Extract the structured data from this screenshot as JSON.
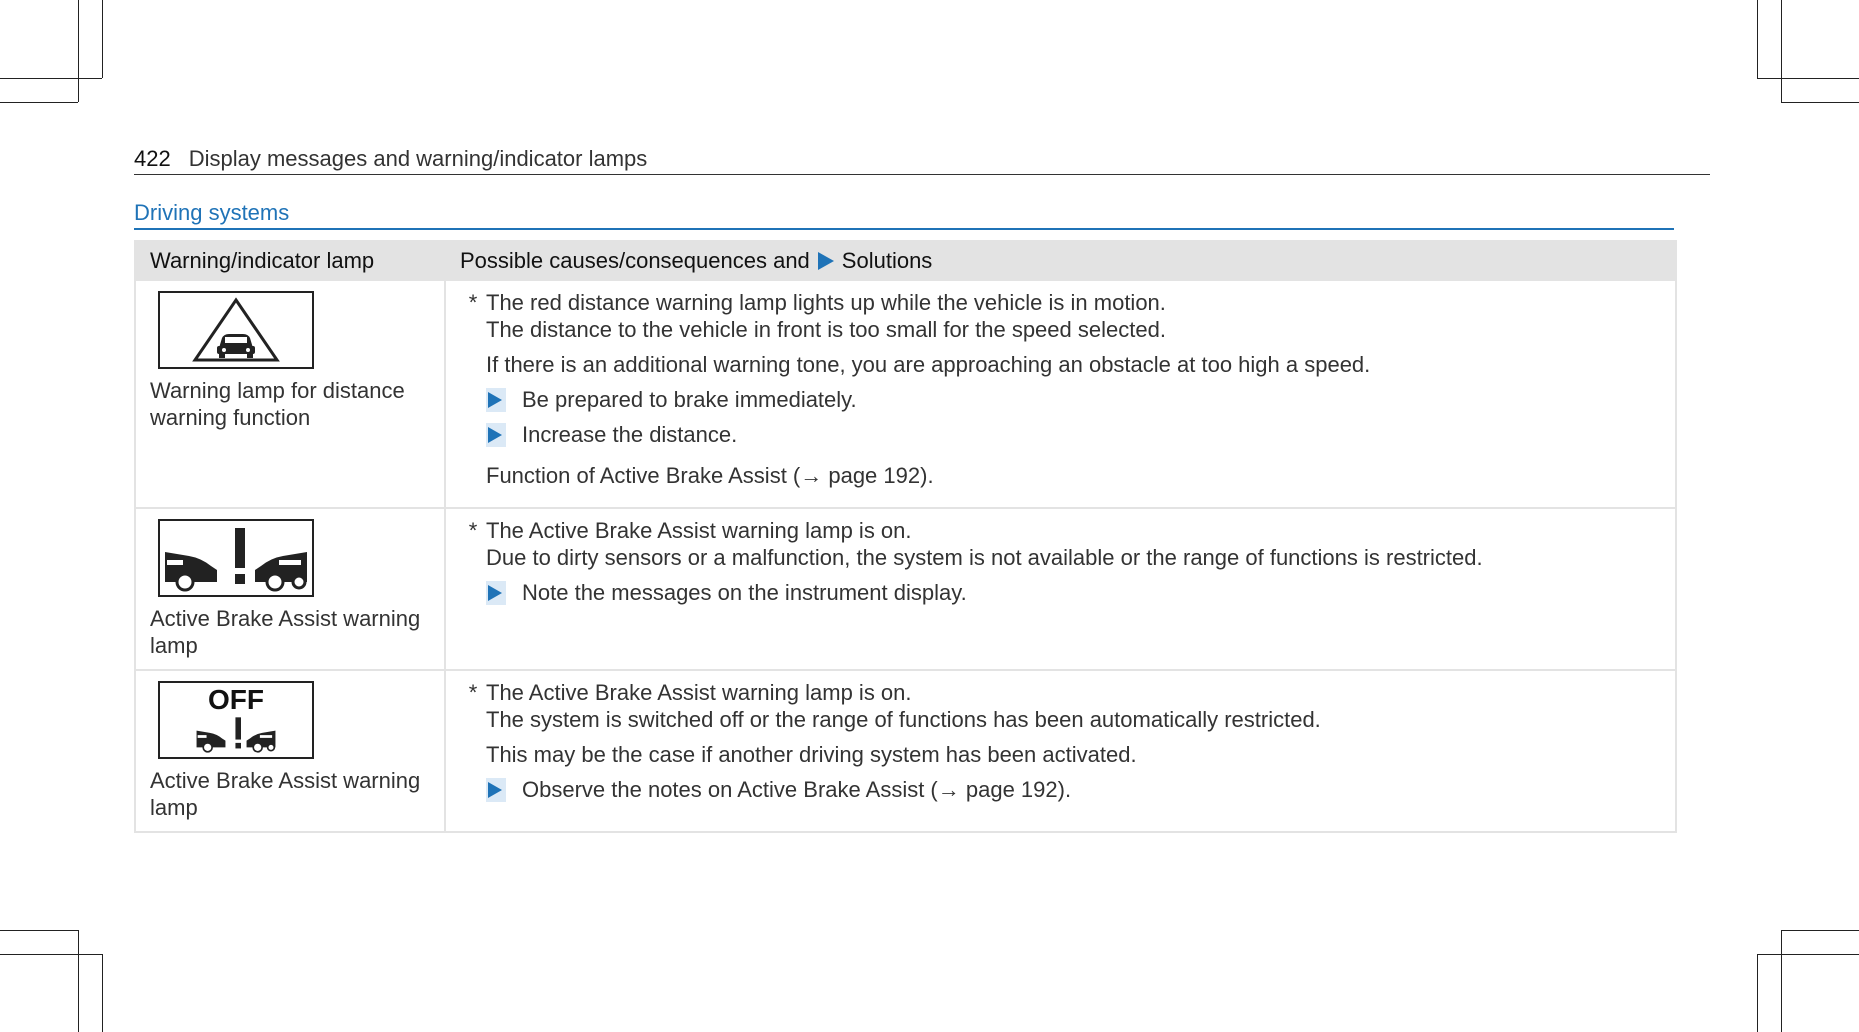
{
  "page": {
    "number": "422",
    "running_head": "Display messages and warning/indicator lamps"
  },
  "section": {
    "title": "Driving systems"
  },
  "table": {
    "headers": {
      "col1": "Warning/indicator lamp",
      "col2_before": "Possible causes/consequences and",
      "col2_after": "Solutions"
    },
    "rows": [
      {
        "icon": "distance-warning-triangle-car-icon",
        "caption": "Warning lamp for distance warning function",
        "cause": "The red distance warning lamp lights up while the vehicle is in motion.",
        "cause_detail": "The distance to the vehicle in front is too small for the speed selected.",
        "paragraph": "If there is an additional warning tone, you are approaching an obstacle at too high a speed.",
        "steps": [
          "Be prepared to brake immediately.",
          "Increase the distance."
        ],
        "footer": "Function of Active Brake Assist (→ page 192)."
      },
      {
        "icon": "active-brake-assist-icon",
        "caption": "Active Brake Assist warning lamp",
        "cause": "The Active Brake Assist warning lamp is on.",
        "cause_detail": "Due to dirty sensors or a malfunction, the system is not available or the range of functions is restricted.",
        "steps": [
          "Note the messages on the instrument display."
        ]
      },
      {
        "icon": "active-brake-assist-off-icon",
        "icon_label": "OFF",
        "caption": "Active Brake Assist warning lamp",
        "cause": "The Active Brake Assist warning lamp is on.",
        "cause_detail": "The system is switched off or the range of functions has been automatically restricted.",
        "paragraph": "This may be the case if another driving system has been activated.",
        "steps": [
          "Observe the notes on Active Brake Assist (→ page 192)."
        ]
      }
    ]
  },
  "colors": {
    "accent": "#1f73b7",
    "header_bg": "#e3e3e3",
    "step_bg": "#dbe9f6"
  }
}
